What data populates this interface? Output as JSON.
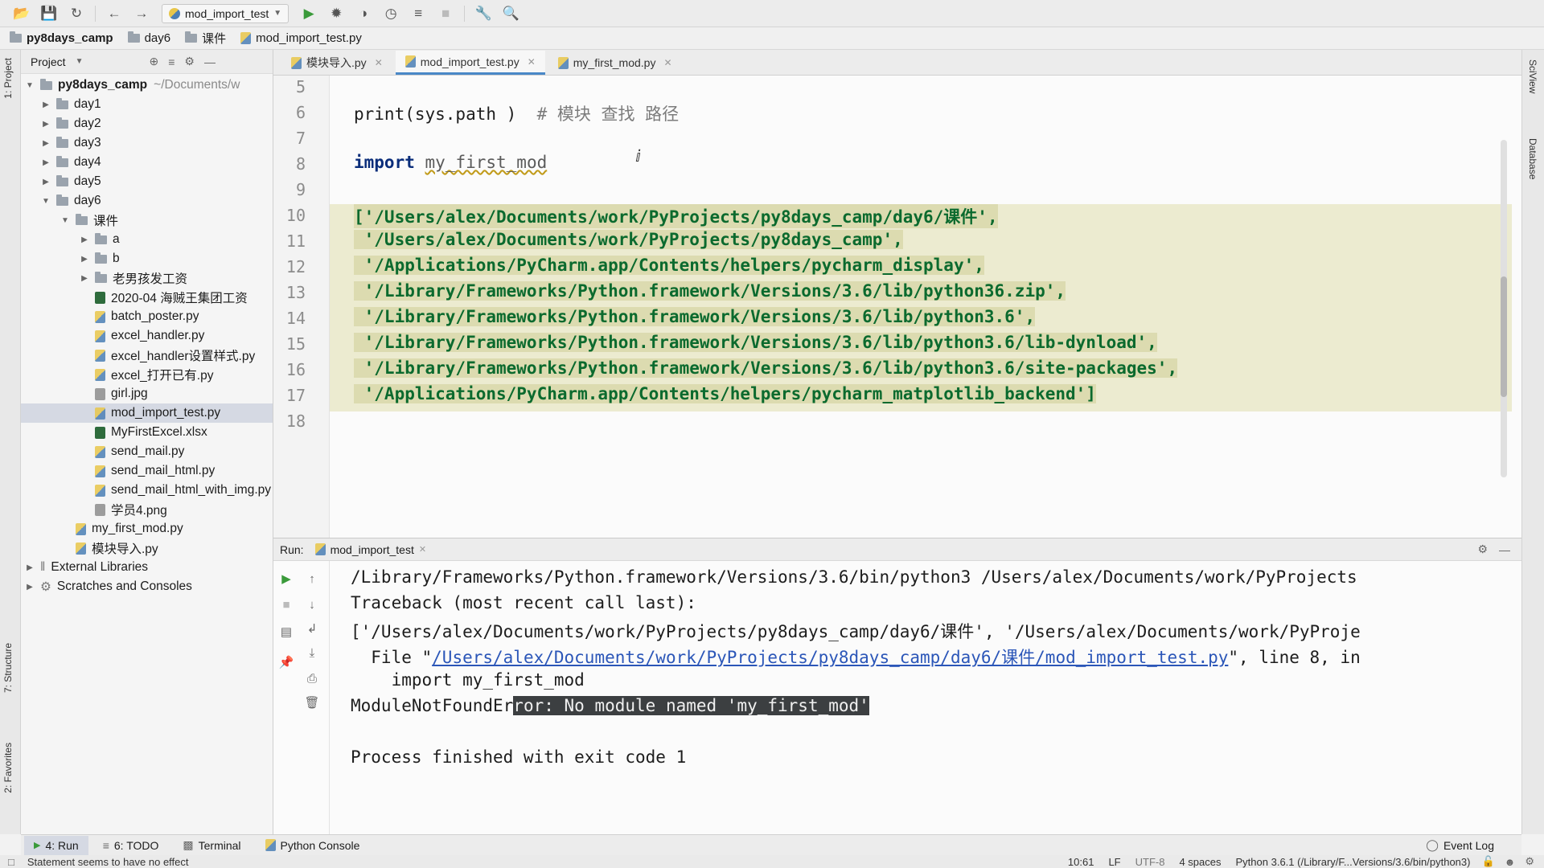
{
  "toolbar": {
    "run_config": "mod_import_test"
  },
  "breadcrumb": [
    "py8days_camp",
    "day6",
    "课件",
    "mod_import_test.py"
  ],
  "project_panel": {
    "title": "Project",
    "root": {
      "name": "py8days_camp",
      "path": "~/Documents/w"
    },
    "items": [
      {
        "label": "day1"
      },
      {
        "label": "day2"
      },
      {
        "label": "day3"
      },
      {
        "label": "day4"
      },
      {
        "label": "day5"
      },
      {
        "label": "day6"
      },
      {
        "label": "课件"
      },
      {
        "label": "a"
      },
      {
        "label": "b"
      },
      {
        "label": "老男孩发工资"
      },
      {
        "label": "2020-04 海贼王集团工资"
      },
      {
        "label": "batch_poster.py"
      },
      {
        "label": "excel_handler.py"
      },
      {
        "label": "excel_handler设置样式.py"
      },
      {
        "label": "excel_打开已有.py"
      },
      {
        "label": "girl.jpg"
      },
      {
        "label": "mod_import_test.py"
      },
      {
        "label": "MyFirstExcel.xlsx"
      },
      {
        "label": "send_mail.py"
      },
      {
        "label": "send_mail_html.py"
      },
      {
        "label": "send_mail_html_with_img.py"
      },
      {
        "label": "学员4.png"
      },
      {
        "label": "my_first_mod.py"
      },
      {
        "label": "模块导入.py"
      },
      {
        "label": "External Libraries"
      },
      {
        "label": "Scratches and Consoles"
      }
    ]
  },
  "editor_tabs": [
    "模块导入.py",
    "mod_import_test.py",
    "my_first_mod.py"
  ],
  "editor": {
    "line_numbers": [
      "5",
      "6",
      "7",
      "8",
      "9",
      "10",
      "11",
      "12",
      "13",
      "14",
      "15",
      "16",
      "17",
      "18"
    ],
    "line6_code": "print(sys.path )",
    "line6_comment": "# 模块 查找 路径",
    "line8_kw": "import",
    "line8_mod": "my_first_mod",
    "sys_path_lines": [
      "['/Users/alex/Documents/work/PyProjects/py8days_camp/day6/课件',",
      " '/Users/alex/Documents/work/PyProjects/py8days_camp',",
      " '/Applications/PyCharm.app/Contents/helpers/pycharm_display',",
      " '/Library/Frameworks/Python.framework/Versions/3.6/lib/python36.zip',",
      " '/Library/Frameworks/Python.framework/Versions/3.6/lib/python3.6',",
      " '/Library/Frameworks/Python.framework/Versions/3.6/lib/python3.6/lib-dynload',",
      " '/Library/Frameworks/Python.framework/Versions/3.6/lib/python3.6/site-packages',",
      " '/Applications/PyCharm.app/Contents/helpers/pycharm_matplotlib_backend']"
    ]
  },
  "run_panel": {
    "label": "Run:",
    "tab": "mod_import_test",
    "output": {
      "cmd": "/Library/Frameworks/Python.framework/Versions/3.6/bin/python3 /Users/alex/Documents/work/PyProjects",
      "traceback": "Traceback (most recent call last):",
      "path_echo": "['/Users/alex/Documents/work/PyProjects/py8days_camp/day6/课件', '/Users/alex/Documents/work/PyProje",
      "file_prefix": "  File \"",
      "file_link": "/Users/alex/Documents/work/PyProjects/py8days_camp/day6/课件/mod_import_test.py",
      "file_suffix": "\", line 8, in",
      "import_line": "    import my_first_mod",
      "error_prefix": "ModuleNotFoundEr",
      "error_highlight": "ror: No module named 'my_first_mod'",
      "finished": "Process finished with exit code 1"
    }
  },
  "bottom_tabs": {
    "run": "4: Run",
    "todo": "6: TODO",
    "terminal": "Terminal",
    "python_console": "Python Console",
    "event_log": "Event Log"
  },
  "left_strip": {
    "project": "1: Project",
    "structure": "7: Structure",
    "favorites": "2: Favorites"
  },
  "right_strip": {
    "sciview": "SciView",
    "database": "Database"
  },
  "status_bar": {
    "message": "Statement seems to have no effect",
    "position": "10:61",
    "line_sep": "LF",
    "encoding": "UTF-8",
    "indent": "4 spaces",
    "interpreter": "Python 3.6.1 (/Library/F...Versions/3.6/bin/python3)"
  }
}
